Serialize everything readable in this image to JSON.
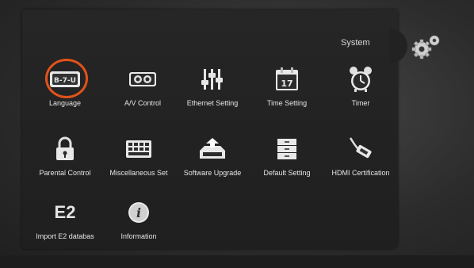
{
  "menu": {
    "title": "System",
    "items": [
      {
        "label": "Language",
        "icon": "language-icon",
        "selected": true
      },
      {
        "label": "A/V Control",
        "icon": "av-control-icon"
      },
      {
        "label": "Ethernet Setting",
        "icon": "ethernet-settings-icon"
      },
      {
        "label": "Time Setting",
        "icon": "calendar-icon",
        "icon_text": "17"
      },
      {
        "label": "Timer",
        "icon": "alarm-clock-icon"
      },
      {
        "label": "Parental Control",
        "icon": "padlock-icon"
      },
      {
        "label": "Miscellaneous Set",
        "icon": "keyboard-icon"
      },
      {
        "label": "Software Upgrade",
        "icon": "upgrade-icon"
      },
      {
        "label": "Default Setting",
        "icon": "default-setting-icon"
      },
      {
        "label": "HDMI Certification",
        "icon": "hdmi-cable-icon"
      },
      {
        "label": "Import E2 databas",
        "icon": "e2-icon",
        "icon_text": "E2"
      },
      {
        "label": "Information",
        "icon": "info-icon"
      }
    ]
  },
  "colors": {
    "selection_ring": "#e2531a",
    "label": "#e6e6e6",
    "panel": "#222222"
  }
}
